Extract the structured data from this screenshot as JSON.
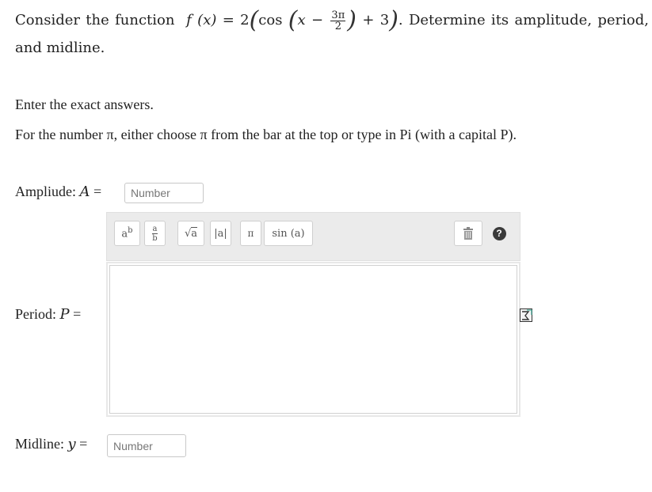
{
  "problem": {
    "intro": "Consider the function",
    "func_name": "f",
    "func_var": "x",
    "coef": "2",
    "trig": "cos",
    "frac_num": "3π",
    "frac_den": "2",
    "plus": "+ 3",
    "question": ". Determine its amplitude, period, and midline."
  },
  "instructions": {
    "line1": "Enter the exact answers.",
    "line2": "For the number π, either choose π from the bar at the top or type in Pi (with a capital P)."
  },
  "amplitude": {
    "label": "Ampliude:",
    "var": "A",
    "placeholder": "Number"
  },
  "period": {
    "label": "Period:",
    "var": "P"
  },
  "midline": {
    "label": "Midline:",
    "var": "y",
    "placeholder": "Number"
  },
  "toolbar": {
    "power_base": "a",
    "power_exp": "b",
    "frac_top": "a",
    "frac_bottom": "b",
    "sqrt_arg": "a",
    "abs_arg": "|a|",
    "pi": "π",
    "sin": "sin (a)",
    "help": "?"
  }
}
